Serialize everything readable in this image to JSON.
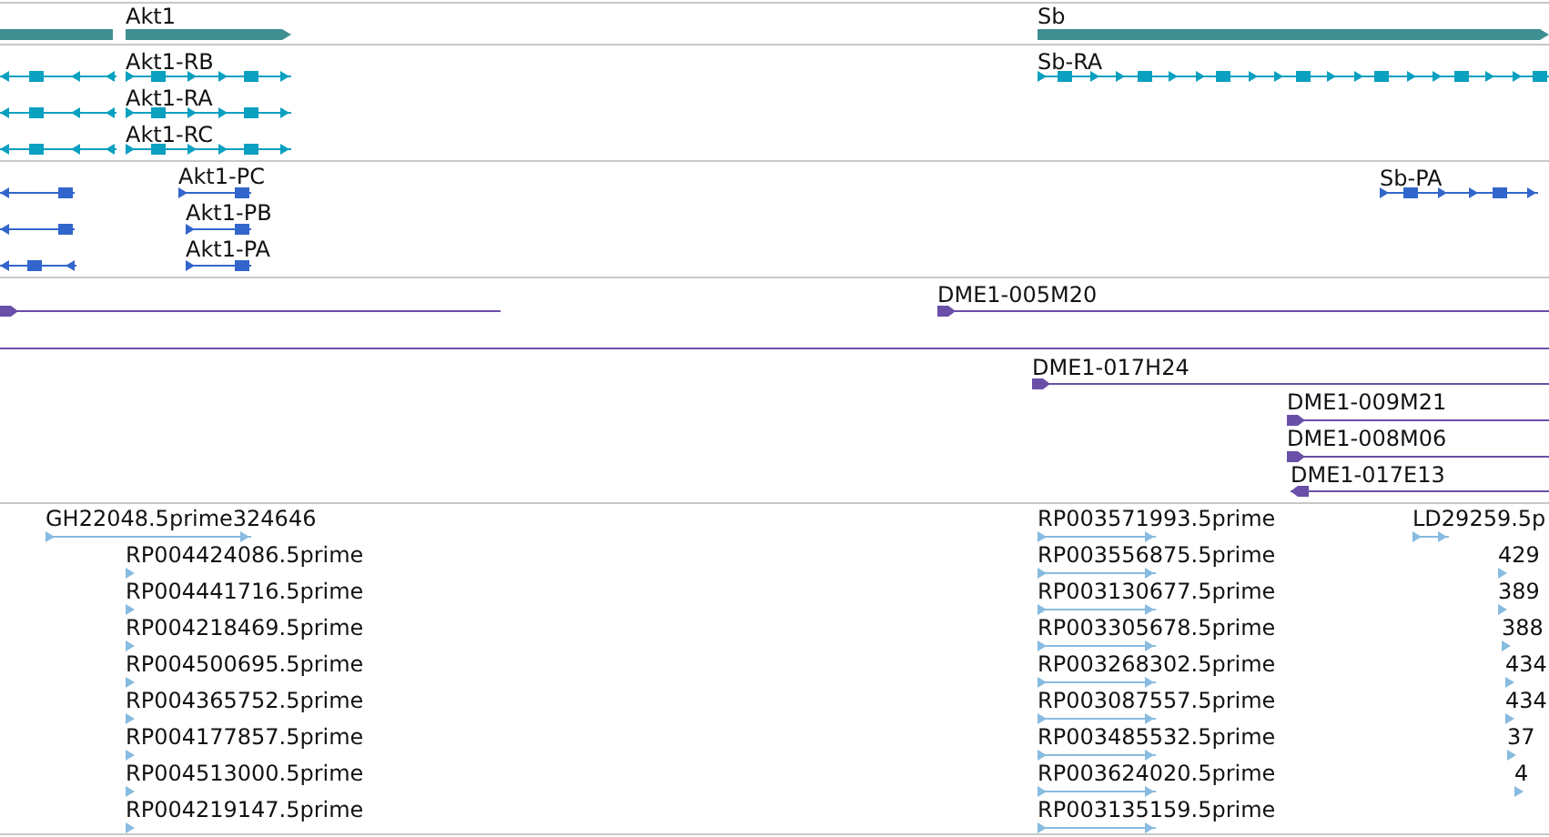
{
  "tracks": [
    {
      "kind": "gene",
      "features": [
        {
          "label": "Akt1"
        },
        {
          "label": "Sb"
        }
      ]
    },
    {
      "kind": "transcript",
      "features": [
        {
          "label": "Akt1-RB"
        },
        {
          "label": "Akt1-RA"
        },
        {
          "label": "Akt1-RC"
        },
        {
          "label": "Sb-RA"
        }
      ]
    },
    {
      "kind": "protein",
      "features": [
        {
          "label": "Akt1-PC"
        },
        {
          "label": "Akt1-PB"
        },
        {
          "label": "Akt1-PA"
        },
        {
          "label": "Sb-PA"
        }
      ]
    },
    {
      "kind": "clone",
      "features": [
        {
          "label": "DME1-005M20"
        },
        {
          "label": "DME1-017H24"
        },
        {
          "label": "DME1-009M21"
        },
        {
          "label": "DME1-008M06"
        },
        {
          "label": "DME1-017E13"
        }
      ]
    },
    {
      "kind": "est",
      "features": [
        {
          "label": "GH22048.5prime324646"
        },
        {
          "label": "RP004424086.5prime"
        },
        {
          "label": "RP004441716.5prime"
        },
        {
          "label": "RP004218469.5prime"
        },
        {
          "label": "RP004500695.5prime"
        },
        {
          "label": "RP004365752.5prime"
        },
        {
          "label": "RP004177857.5prime"
        },
        {
          "label": "RP004513000.5prime"
        },
        {
          "label": "RP004219147.5prime"
        },
        {
          "label": "RP003571993.5prime"
        },
        {
          "label": "RP003556875.5prime"
        },
        {
          "label": "RP003130677.5prime"
        },
        {
          "label": "RP003305678.5prime"
        },
        {
          "label": "RP003268302.5prime"
        },
        {
          "label": "RP003087557.5prime"
        },
        {
          "label": "RP003485532.5prime"
        },
        {
          "label": "RP003624020.5prime"
        },
        {
          "label": "RP003135159.5prime"
        },
        {
          "label": "LD29259.5p"
        },
        {
          "label": "429"
        },
        {
          "label": "389"
        },
        {
          "label": "388"
        },
        {
          "label": "434"
        },
        {
          "label": "434"
        },
        {
          "label": "37"
        },
        {
          "label": "4"
        }
      ]
    }
  ]
}
